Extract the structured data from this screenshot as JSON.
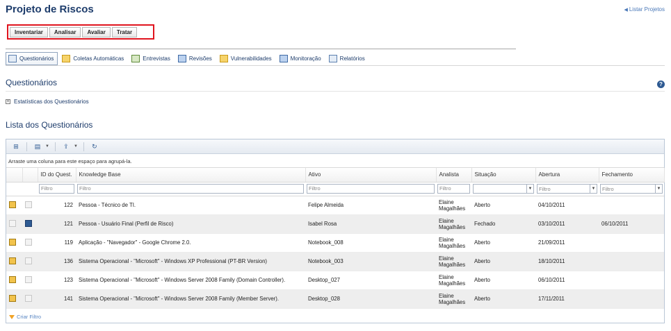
{
  "page": {
    "title": "Projeto de Riscos",
    "list_projects": "Listar Projetos"
  },
  "phases": [
    "Inventariar",
    "Analisar",
    "Avaliar",
    "Tratar"
  ],
  "tabs": [
    {
      "label": "Questionários",
      "icon": "form-icon",
      "active": true
    },
    {
      "label": "Coletas Automáticas",
      "icon": "auto-collect-icon",
      "active": false
    },
    {
      "label": "Entrevistas",
      "icon": "interview-icon",
      "active": false
    },
    {
      "label": "Revisões",
      "icon": "review-icon",
      "active": false
    },
    {
      "label": "Vulnerabilidades",
      "icon": "vulnerability-icon",
      "active": false
    },
    {
      "label": "Monitoração",
      "icon": "monitor-icon",
      "active": false
    },
    {
      "label": "Relatórios",
      "icon": "report-icon",
      "active": false
    }
  ],
  "section": {
    "title": "Questionários",
    "stats_link": "Estatísticas dos Questionários",
    "list_title": "Lista dos Questionários"
  },
  "grid": {
    "group_hint": "Arraste uma coluna para este espaço para agrupá-la.",
    "columns": [
      "ID do Quest.",
      "Knowledge Base",
      "Ativo",
      "Analista",
      "Situação",
      "Abertura",
      "Fechamento"
    ],
    "filter_placeholder": "Filtro",
    "rows": [
      {
        "id": "122",
        "kb": "Pessoa - Técnico de TI.",
        "ativo": "Felipe Almeida",
        "analista": "Elaine Magalhães",
        "situacao": "Aberto",
        "abertura": "04/10/2011",
        "fechamento": ""
      },
      {
        "id": "121",
        "kb": "Pessoa - Usuário Final (Perfil de Risco)",
        "ativo": "Isabel Rosa",
        "analista": "Elaine Magalhães",
        "situacao": "Fechado",
        "abertura": "03/10/2011",
        "fechamento": "06/10/2011"
      },
      {
        "id": "119",
        "kb": "Aplicação - \"Navegador\" - Google Chrome 2.0.",
        "ativo": "Notebook_008",
        "analista": "Elaine Magalhães",
        "situacao": "Aberto",
        "abertura": "21/09/2011",
        "fechamento": ""
      },
      {
        "id": "136",
        "kb": "Sistema Operacional - \"Microsoft\" - Windows XP Professional (PT-BR Version)",
        "ativo": "Notebook_003",
        "analista": "Elaine Magalhães",
        "situacao": "Aberto",
        "abertura": "18/10/2011",
        "fechamento": ""
      },
      {
        "id": "123",
        "kb": "Sistema Operacional - \"Microsoft\" - Windows Server 2008 Family (Domain Controller).",
        "ativo": "Desktop_027",
        "analista": "Elaine Magalhães",
        "situacao": "Aberto",
        "abertura": "06/10/2011",
        "fechamento": ""
      },
      {
        "id": "141",
        "kb": "Sistema Operacional - \"Microsoft\" - Windows Server 2008 Family (Member Server).",
        "ativo": "Desktop_028",
        "analista": "Elaine Magalhães",
        "situacao": "Aberto",
        "abertura": "17/11/2011",
        "fechamento": ""
      }
    ],
    "create_filter": "Criar Filtro"
  },
  "colors": {
    "title": "#1d3c6b",
    "highlight": "#e0141e",
    "link": "#4a78b8"
  }
}
